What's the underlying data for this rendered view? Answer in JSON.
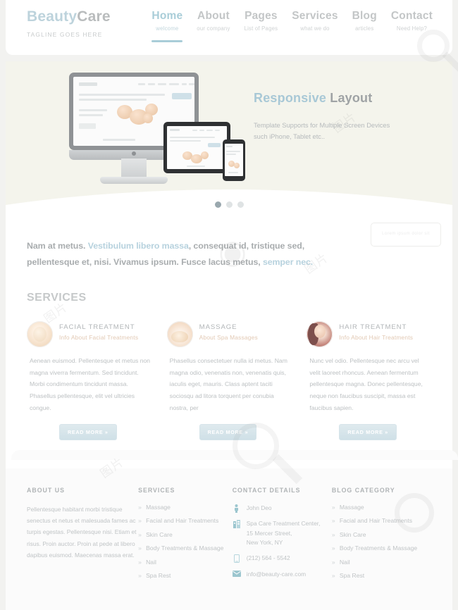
{
  "header": {
    "logo_primary": "Beauty",
    "logo_secondary": "Care",
    "tagline": "TAGLINE GOES HERE",
    "nav": [
      {
        "label": "Home",
        "sub": "welcome",
        "active": true
      },
      {
        "label": "About",
        "sub": "our company",
        "active": false
      },
      {
        "label": "Pages",
        "sub": "List of Pages",
        "active": false
      },
      {
        "label": "Services",
        "sub": "what we do",
        "active": false
      },
      {
        "label": "Blog",
        "sub": "articles",
        "active": false
      },
      {
        "label": "Contact",
        "sub": "Need Help?",
        "active": false
      }
    ]
  },
  "hero": {
    "title_accent": "Responsive",
    "title_rest": " Layout",
    "subtitle_line1": "Template Supports for Multiple Screen Devices",
    "subtitle_line2": "such iPhone, Tablet etc..",
    "dots": [
      {
        "active": true
      },
      {
        "active": false
      },
      {
        "active": false
      }
    ]
  },
  "intro": {
    "p1": "Nam at metus. ",
    "hl1": "Vestibulum libero massa",
    "p2": ", consequat id, tristique sed, pellentesque et, nisi. Vivamus ipsum. Fusce lacus metus, ",
    "hl2": "semper nec.",
    "box_label": "Lorem ipsum dolor sit"
  },
  "services": {
    "section_title": "SERVICES",
    "items": [
      {
        "title": "FACIAL TREATMENT",
        "subtitle": "Info About Facial Treatments",
        "body": "Aenean euismod. Pellentesque et metus non magna viverra fermentum. Sed tincidunt. Morbi condimentum tincidunt massa. Phasellus pellentesque, elit vel ultricies congue.",
        "button": "READ MORE »"
      },
      {
        "title": "MASSAGE",
        "subtitle": "About Spa Massages",
        "body": "Phasellus consectetuer nulla id metus. Nam magna odio, venenatis non, venenatis quis, iaculis eget, mauris. Class aptent taciti sociosqu ad litora torquent per conubia nostra, per",
        "button": "READ MORE »"
      },
      {
        "title": "HAIR TREATMENT",
        "subtitle": "Info About Hair Treatments",
        "body": "Nunc vel odio. Pellentesque nec arcu vel velit laoreet rhoncus. Aenean fermentum pellentesque magna. Donec pellentesque, neque non faucibus suscipit, massa est faucibus sapien.",
        "button": "READ MORE »"
      }
    ]
  },
  "footer": {
    "about": {
      "heading": "ABOUT US",
      "text": "Pellentesque habitant morbi tristique senectus et netus et malesuada fames ac turpis egestas. Pellentesque nisi. Etiam et risus. Proin auctor. Proin at pede at libero dapibus euismod. Maecenas massa erat."
    },
    "services": {
      "heading": "SERVICES",
      "items": [
        "Massage",
        "Facial and Hair Treatments",
        "Skin Care",
        "Body Treatments & Massage",
        "Nail",
        "Spa Rest"
      ]
    },
    "contact": {
      "heading": "CONTACT DETAILS",
      "name": "John Deo",
      "address_line1": "Spa Care Treatment Center,",
      "address_line2": "15 Mercer Street,",
      "address_line3": "New York, NY",
      "phone": "(212) 564 - 5542",
      "email": "info@beauty-care.com"
    },
    "blog": {
      "heading": "BLOG CATEGORY",
      "items": [
        "Massage",
        "Facial and Hair Treatments",
        "Skin Care",
        "Body Treatments & Massage",
        "Nail",
        "Spa Rest"
      ]
    }
  },
  "colors": {
    "accent_teal": "#a9cdd8",
    "text_gray": "#b9bcbd",
    "hero_bg": "#f4f4ec",
    "page_bg": "#f2f2f0"
  }
}
